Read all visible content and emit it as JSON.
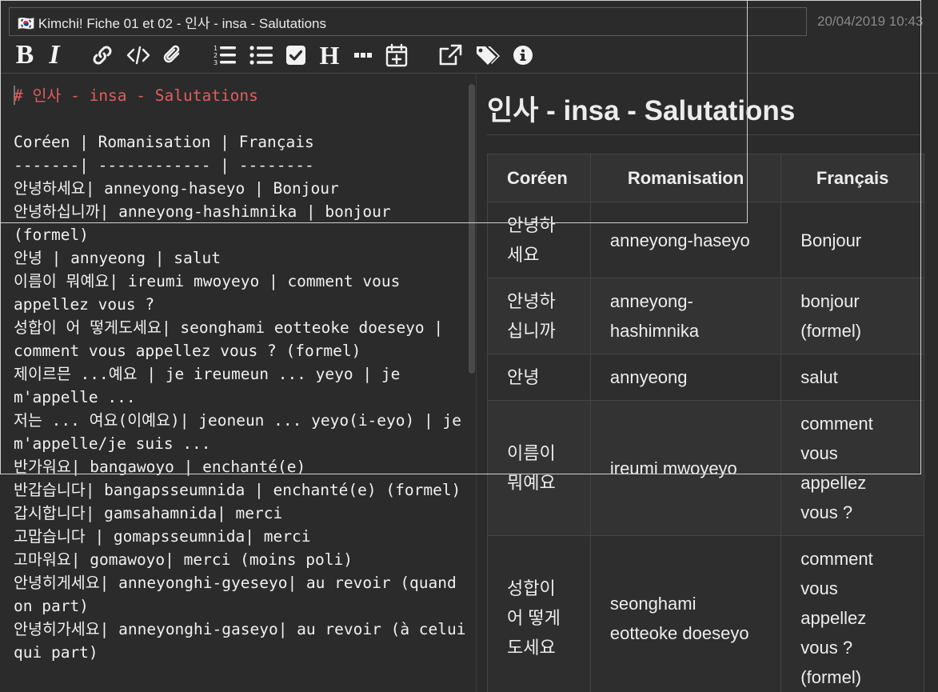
{
  "header": {
    "title": "🇰🇷 Kimchi! Fiche 01 et 02 - 인사 - insa - Salutations",
    "timestamp": "20/04/2019 10:43"
  },
  "toolbar": {
    "items": [
      {
        "name": "bold",
        "label": "B"
      },
      {
        "name": "italic",
        "label": "I"
      },
      {
        "name": "link",
        "icon": "link-icon"
      },
      {
        "name": "code",
        "icon": "code-icon"
      },
      {
        "name": "attach",
        "icon": "paperclip-icon"
      },
      {
        "name": "numbered-list",
        "icon": "numbered-list-icon"
      },
      {
        "name": "bullet-list",
        "icon": "bullet-list-icon"
      },
      {
        "name": "checkbox",
        "icon": "checkbox-icon"
      },
      {
        "name": "heading",
        "label": "H"
      },
      {
        "name": "horizontal-rule",
        "icon": "ellipsis-icon"
      },
      {
        "name": "insert-date",
        "icon": "calendar-plus-icon"
      },
      {
        "name": "open-external",
        "icon": "external-link-icon"
      },
      {
        "name": "tags",
        "icon": "tags-icon"
      },
      {
        "name": "info",
        "icon": "info-icon"
      }
    ]
  },
  "editor": {
    "heading_line": "# 인사 - insa - Salutations",
    "body_text": "\nCoréen | Romanisation | Français\n-------| ------------ | --------\n안녕하세요| anneyong-haseyo | Bonjour\n안녕하십니까| anneyong-hashimnika | bonjour (formel)\n안녕 | annyeong | salut\n이름이 뭐예요| ireumi mwoyeyo | comment vous appellez vous ?\n성합이 어 떻게도세요| seonghami eotteoke doeseyo | comment vous appellez vous ? (formel)\n제이르믄 ...예요 | je ireumeun ... yeyo | je m'appelle ...\n저는 ... 여요(이예요)| jeoneun ... yeyo(i-eyo) | je m'appelle/je suis ...\n반가워요| bangawoyo | enchanté(e)\n반갑습니다| bangapsseumnida | enchanté(e) (formel)\n갑시합니다| gamsahamnida| merci\n고맙습니다 | gomapsseumnida| merci\n고마워요| gomawoyo| merci (moins poli)\n안녕히게세요| anneyonghi-gyeseyo| au revoir (quand on part)\n안녕히가세요| anneyonghi-gaseyo| au revoir (à celui qui part)"
  },
  "preview": {
    "heading": "인사 - insa - Salutations",
    "table": {
      "headers": [
        "Coréen",
        "Romanisation",
        "Français"
      ],
      "rows": [
        [
          "안녕하세요",
          "anneyong-haseyo",
          "Bonjour"
        ],
        [
          "안녕하십니까",
          "anneyong-hashimnika",
          "bonjour (formel)"
        ],
        [
          "안녕",
          "annyeong",
          "salut"
        ],
        [
          "이름이 뭐예요",
          "ireumi mwoyeyo",
          "comment vous appellez vous ?"
        ],
        [
          "성합이 어 떻게도세요",
          "seonghami eotteoke doeseyo",
          "comment vous appellez vous ? (formel)"
        ]
      ]
    }
  }
}
